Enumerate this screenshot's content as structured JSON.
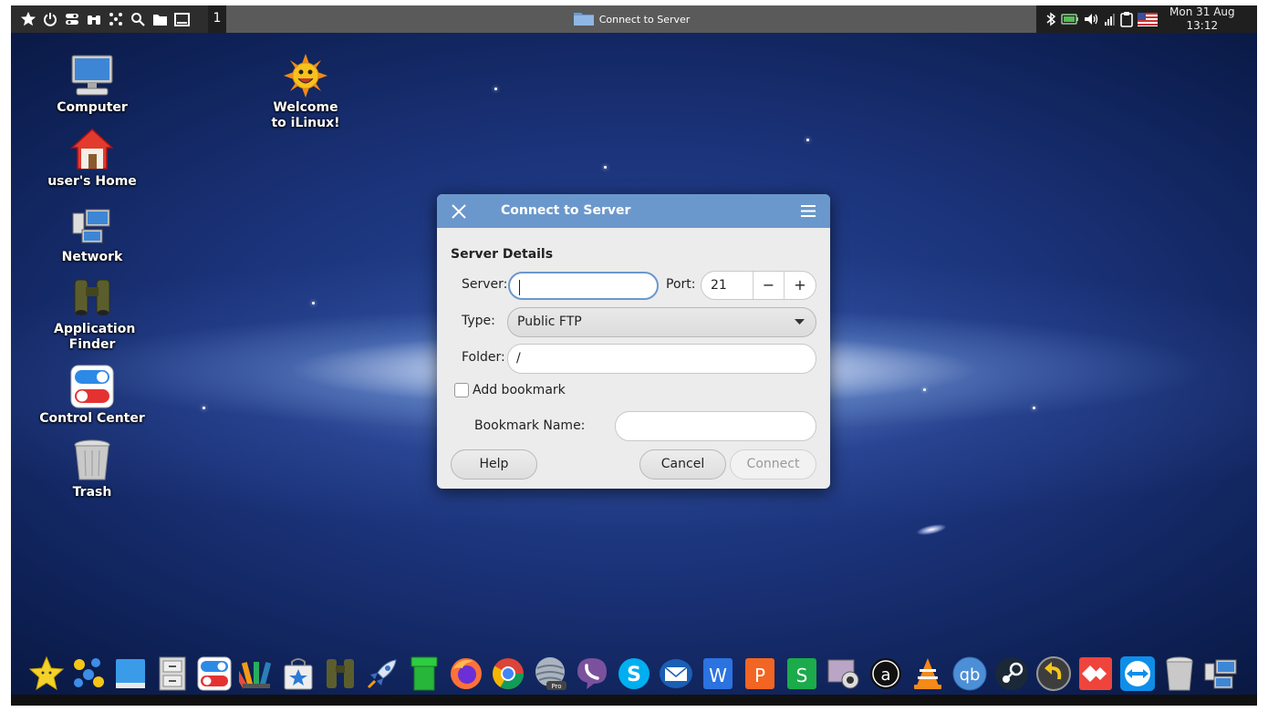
{
  "topbar": {
    "workspace": "1",
    "window_title": "Connect to Server",
    "clock_date": "Mon 31 Aug",
    "clock_time": "13:12"
  },
  "desktop_icons": {
    "computer": "Computer",
    "home": "user's Home",
    "network": "Network",
    "appfinder": "Application Finder",
    "control": "Control Center",
    "trash": "Trash",
    "welcome": "Welcome to iLinux!"
  },
  "dialog": {
    "title": "Connect to Server",
    "section": "Server Details",
    "server_label": "Server:",
    "server_value": "",
    "port_label": "Port:",
    "port_value": "21",
    "type_label": "Type:",
    "type_value": "Public FTP",
    "folder_label": "Folder:",
    "folder_value": "/",
    "bookmark_label": "Add bookmark",
    "bookmark_checked": false,
    "bookmark_name_label": "Bookmark Name:",
    "bookmark_name_value": "",
    "help_label": "Help",
    "cancel_label": "Cancel",
    "connect_label": "Connect",
    "minus": "−",
    "plus": "+"
  },
  "colors": {
    "dialog_header": "#6b98cc",
    "panel": "#2d2d2d",
    "taskbar": "#5a5a5a"
  },
  "dock": [
    "favorites-icon",
    "launcher-icon",
    "desktop-icon",
    "file-cabinet-icon",
    "control-toggle-icon",
    "palette-icon",
    "store-icon",
    "binoculars-icon",
    "rocket-icon",
    "pipe-icon",
    "firefox-icon",
    "chrome-icon",
    "earth-pro-icon",
    "viber-icon",
    "skype-icon",
    "mail-icon",
    "writer-icon",
    "presentation-icon",
    "spreadsheet-icon",
    "webcam-icon",
    "amazon-icon",
    "vlc-icon",
    "qbittorrent-icon",
    "steam-icon",
    "backup-icon",
    "anydesk-icon",
    "teamviewer-icon",
    "trash-icon",
    "network-icon"
  ]
}
